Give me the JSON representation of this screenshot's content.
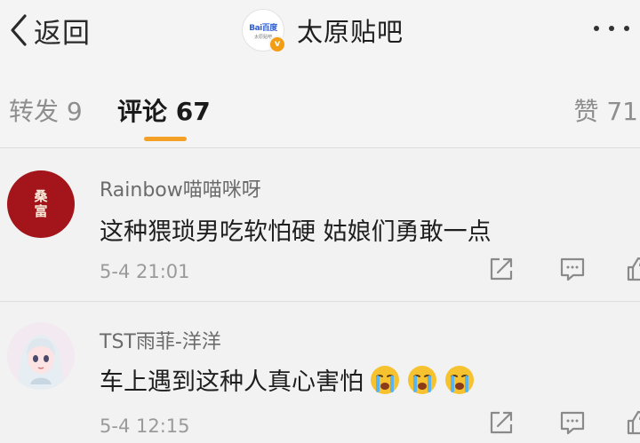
{
  "navbar": {
    "back_label": "返回",
    "account_name": "太原贴吧",
    "logo_text": "Bai百度",
    "logo_subtext": "太原贴吧"
  },
  "tabs": {
    "repost": "转发 9",
    "comments": "评论 67",
    "likes": "赞 71",
    "active": "comments"
  },
  "colors": {
    "accent": "#f4a027",
    "verify_badge": "#f29d12",
    "avatar_red": "#a3151b"
  },
  "comments": [
    {
      "username": "Rainbow喵喵咪呀",
      "avatar_text": "桑富",
      "text": "这种猥琐男吃软怕硬 姑娘们勇敢一点",
      "emojis": [],
      "time": "5-4 21:01",
      "actions": [
        "share-icon",
        "reply-icon",
        "like-icon"
      ]
    },
    {
      "username": "TST雨菲-洋洋",
      "text": "车上遇到这种人真心害怕",
      "emojis": [
        "crying-emoji",
        "crying-emoji",
        "crying-emoji"
      ],
      "time": "5-4 12:15",
      "actions": [
        "share-icon",
        "reply-icon",
        "like-icon"
      ]
    }
  ]
}
